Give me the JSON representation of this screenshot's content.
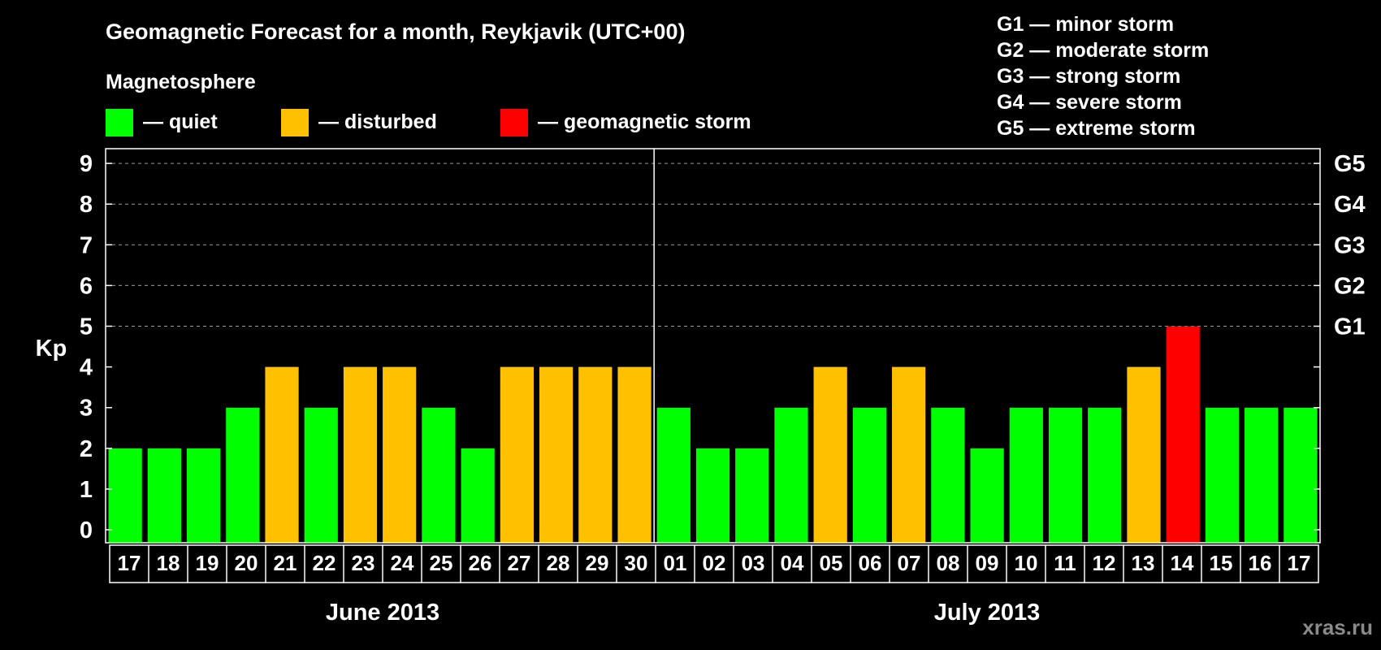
{
  "chart_data": {
    "type": "bar",
    "title": "Geomagnetic Forecast for a month, Reykjavik (UTC+00)",
    "subtitle": "Magnetosphere",
    "ylabel": "Kp",
    "xlabel": "",
    "ylim": [
      0,
      9
    ],
    "yticks": [
      "0",
      "1",
      "2",
      "3",
      "4",
      "5",
      "6",
      "7",
      "8",
      "9"
    ],
    "grid": true,
    "legend": [
      {
        "label": "— quiet",
        "color": "#00ff00"
      },
      {
        "label": "— disturbed",
        "color": "#ffc000"
      },
      {
        "label": "— geomagnetic storm",
        "color": "#ff0000"
      }
    ],
    "storm_scale": [
      {
        "label": "G1 — minor storm",
        "kp": 5,
        "axis_label": "G1"
      },
      {
        "label": "G2 — moderate storm",
        "kp": 6,
        "axis_label": "G2"
      },
      {
        "label": "G3 — strong storm",
        "kp": 7,
        "axis_label": "G3"
      },
      {
        "label": "G4 — severe storm",
        "kp": 8,
        "axis_label": "G4"
      },
      {
        "label": "G5 — extreme storm",
        "kp": 9,
        "axis_label": "G5"
      }
    ],
    "months": [
      {
        "label": "June 2013",
        "start_index": 0,
        "count": 14
      },
      {
        "label": "July 2013",
        "start_index": 14,
        "count": 17
      }
    ],
    "categories": [
      "17",
      "18",
      "19",
      "20",
      "21",
      "22",
      "23",
      "24",
      "25",
      "26",
      "27",
      "28",
      "29",
      "30",
      "01",
      "02",
      "03",
      "04",
      "05",
      "06",
      "07",
      "08",
      "09",
      "10",
      "11",
      "12",
      "13",
      "14",
      "15",
      "16",
      "17"
    ],
    "values": [
      2,
      2,
      2,
      3,
      4,
      3,
      4,
      4,
      3,
      2,
      4,
      4,
      4,
      4,
      3,
      2,
      2,
      3,
      4,
      3,
      4,
      3,
      2,
      3,
      3,
      3,
      4,
      5,
      3,
      3,
      3
    ],
    "status": [
      "quiet",
      "quiet",
      "quiet",
      "quiet",
      "disturbed",
      "quiet",
      "disturbed",
      "disturbed",
      "quiet",
      "quiet",
      "disturbed",
      "disturbed",
      "disturbed",
      "disturbed",
      "quiet",
      "quiet",
      "quiet",
      "quiet",
      "disturbed",
      "quiet",
      "disturbed",
      "quiet",
      "quiet",
      "quiet",
      "quiet",
      "quiet",
      "disturbed",
      "storm",
      "quiet",
      "quiet",
      "quiet"
    ],
    "colors": {
      "quiet": "#00ff00",
      "disturbed": "#ffc000",
      "storm": "#ff0000"
    }
  },
  "watermark": "xras.ru"
}
